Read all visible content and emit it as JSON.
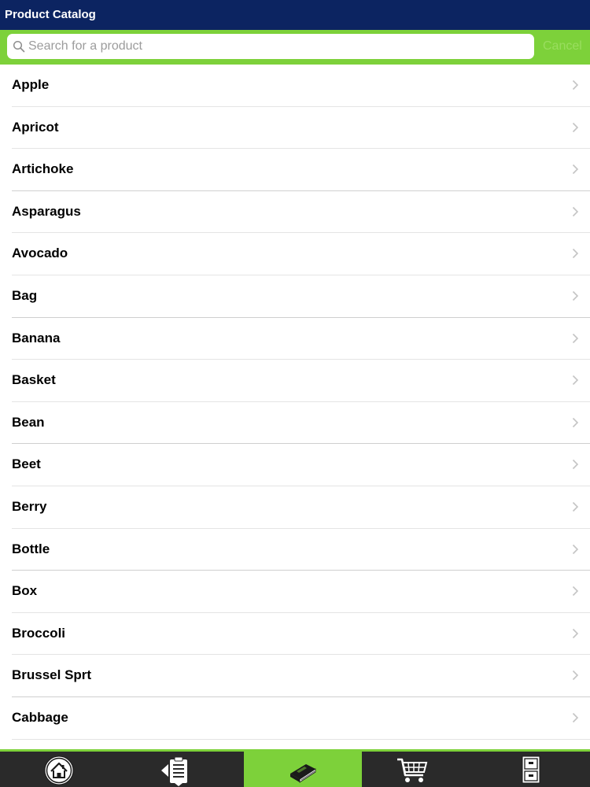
{
  "header": {
    "title": "Product Catalog"
  },
  "search": {
    "placeholder": "Search for a product",
    "cancel_label": "Cancel"
  },
  "products": [
    "Apple",
    "Apricot",
    "Artichoke",
    "Asparagus",
    "Avocado",
    "Bag",
    "Banana",
    "Basket",
    "Bean",
    "Beet",
    "Berry",
    "Bottle",
    "Box",
    "Broccoli",
    "Brussel Sprt",
    "Cabbage"
  ],
  "tabs": [
    {
      "name": "home-icon"
    },
    {
      "name": "clipboard-icon"
    },
    {
      "name": "catalog-book-icon",
      "active": true
    },
    {
      "name": "shopping-cart-icon"
    },
    {
      "name": "file-cabinet-icon"
    }
  ],
  "colors": {
    "header": "#0c2461",
    "accent": "#7dd13a",
    "tabbar": "#2a2a2a"
  }
}
